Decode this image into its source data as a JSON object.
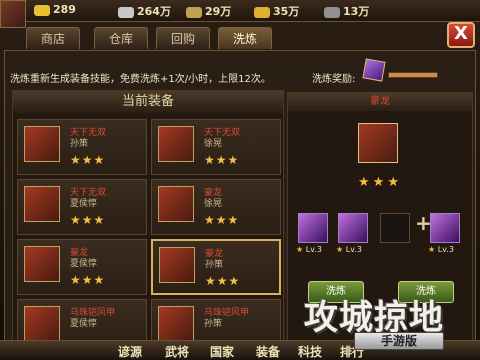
{
  "resources": [
    {
      "icon": "gold-ingot-icon",
      "value": "289",
      "color": "#e8c030"
    },
    {
      "icon": "silver-ingot-icon",
      "value": "264万",
      "color": "#c8c8c8"
    },
    {
      "icon": "grain-icon",
      "value": "29万",
      "color": "#c0a050"
    },
    {
      "icon": "wood-icon",
      "value": "35万",
      "color": "#e0b030"
    },
    {
      "icon": "stone-icon",
      "value": "13万",
      "color": "#909090"
    }
  ],
  "tabs": [
    {
      "label": "商店",
      "active": false
    },
    {
      "label": "仓库",
      "active": false
    },
    {
      "label": "回购",
      "active": false
    },
    {
      "label": "洗炼",
      "active": true
    }
  ],
  "close_label": "X",
  "info_text": "洗炼重新生成装备技能，免费洗炼+1次/小时，上限12次。",
  "reward_label": "洗炼奖励:",
  "left_header": "当前装备",
  "equipment": [
    {
      "name": "天下无双",
      "sub": "孙策",
      "stars": "★★★"
    },
    {
      "name": "天下无双",
      "sub": "徐晃",
      "stars": "★★★"
    },
    {
      "name": "天下无双",
      "sub": "夏侯惇",
      "stars": "★★★"
    },
    {
      "name": "豪龙",
      "sub": "徐晃",
      "stars": "★★★"
    },
    {
      "name": "豪龙",
      "sub": "夏侯惇",
      "stars": "★★★"
    },
    {
      "name": "豪龙",
      "sub": "孙策",
      "stars": "★★★"
    },
    {
      "name": "乌珠铠风甲",
      "sub": "夏侯惇",
      "stars": ""
    },
    {
      "name": "乌珠铠风甲",
      "sub": "孙策",
      "stars": ""
    }
  ],
  "selected": {
    "name": "豪龙",
    "stars": "★★★"
  },
  "gems": [
    {
      "level": "Lv.3",
      "star": "★"
    },
    {
      "level": "Lv.3",
      "star": "★"
    },
    {
      "level": "Lv.3",
      "star": "★"
    }
  ],
  "buttons": {
    "wash_label": "洗炼",
    "super_wash_label": "洗炼"
  },
  "watermark": "攻城掠地",
  "badge": "手游版",
  "bottom_nav": [
    "谚源",
    "武将",
    "国家",
    "装备",
    "科技",
    "排行"
  ]
}
